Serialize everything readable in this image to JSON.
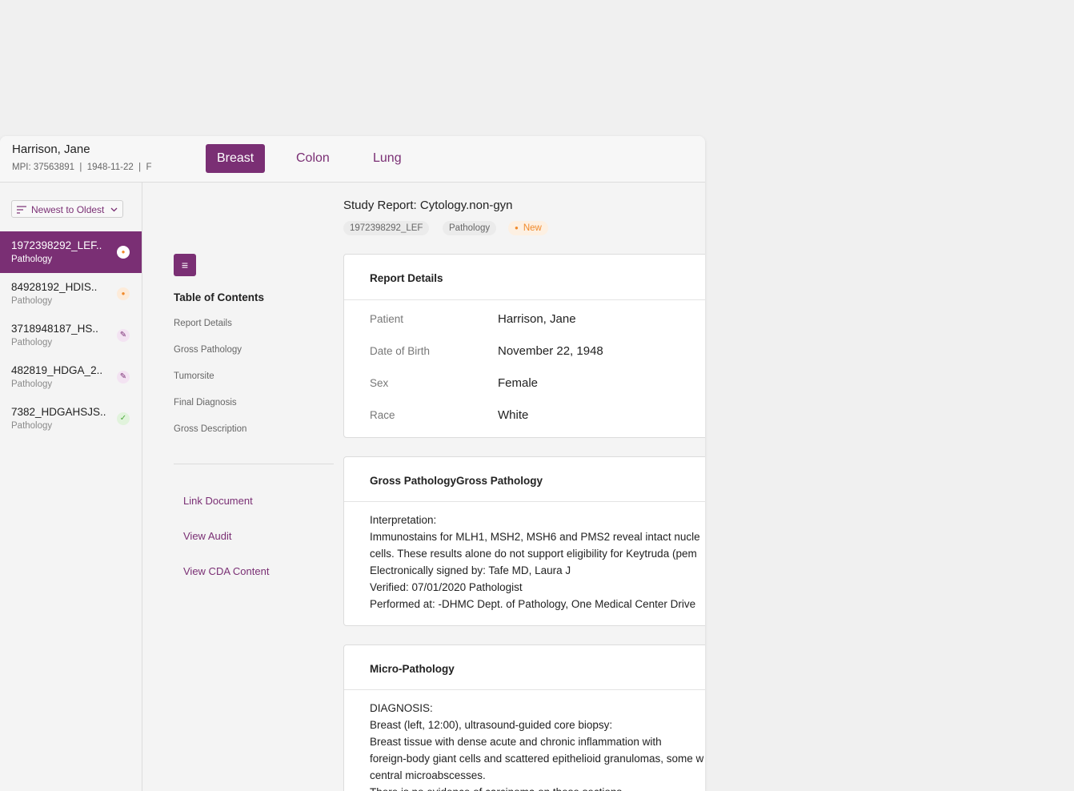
{
  "header": {
    "patient_name": "Harrison, Jane",
    "patient_meta": "MPI: 37563891  |  1948-11-22  |  F",
    "tabs": [
      {
        "label": "Breast",
        "active": true
      },
      {
        "label": "Colon",
        "active": false
      },
      {
        "label": "Lung",
        "active": false
      }
    ]
  },
  "sidebar": {
    "sort_label": "Newest to Oldest",
    "sort_icon": "sort-lines-icon",
    "documents": [
      {
        "title": "1972398292_LEF..",
        "subtitle": "Pathology",
        "status": "new",
        "active": true
      },
      {
        "title": "84928192_HDIS..",
        "subtitle": "Pathology",
        "status": "new",
        "active": false
      },
      {
        "title": "3718948187_HS..",
        "subtitle": "Pathology",
        "status": "edit",
        "active": false
      },
      {
        "title": "482819_HDGA_2..",
        "subtitle": "Pathology",
        "status": "edit",
        "active": false
      },
      {
        "title": "7382_HDGAHSJS..",
        "subtitle": "Pathology",
        "status": "done",
        "active": false
      }
    ]
  },
  "toc": {
    "title": "Table of Contents",
    "items": [
      "Report Details",
      "Gross Pathology",
      "Tumorsite",
      "Final Diagnosis",
      "Gross Description"
    ],
    "actions": [
      "Link Document",
      "View Audit",
      "View CDA Content"
    ]
  },
  "report": {
    "title": "Study Report: Cytology.non-gyn",
    "chips": {
      "id": "1972398292_LEF",
      "type": "Pathology",
      "status": "New"
    },
    "details": {
      "heading": "Report Details",
      "rows": [
        {
          "label": "Patient",
          "value": "Harrison, Jane"
        },
        {
          "label": "Date of Birth",
          "value": "November 22, 1948"
        },
        {
          "label": "Sex",
          "value": "Female"
        },
        {
          "label": "Race",
          "value": "White"
        }
      ]
    },
    "gross": {
      "heading": "Gross PathologyGross Pathology",
      "lines": [
        "Interpretation:",
        "Immunostains for MLH1, MSH2, MSH6 and PMS2 reveal intact nucle",
        "cells. These results alone do not support eligibility for Keytruda (pem",
        "Electronically signed by: Tafe MD, Laura J",
        "Verified: 07/01/2020 Pathologist",
        "Performed at: -DHMC Dept. of Pathology, One Medical Center Drive"
      ]
    },
    "micro": {
      "heading": "Micro-Pathology",
      "lines": [
        "DIAGNOSIS:",
        "Breast (left, 12:00), ultrasound-guided core biopsy:",
        "Breast tissue with dense acute and chronic inflammation with",
        "foreign-body giant cells and scattered epithelioid granulomas, some w",
        "central microabscesses.",
        "There is no evidence of carcinoma on these sections."
      ]
    }
  },
  "colors": {
    "accent": "#7a2f74",
    "new": "#f08a2c",
    "done": "#4caa3c"
  }
}
